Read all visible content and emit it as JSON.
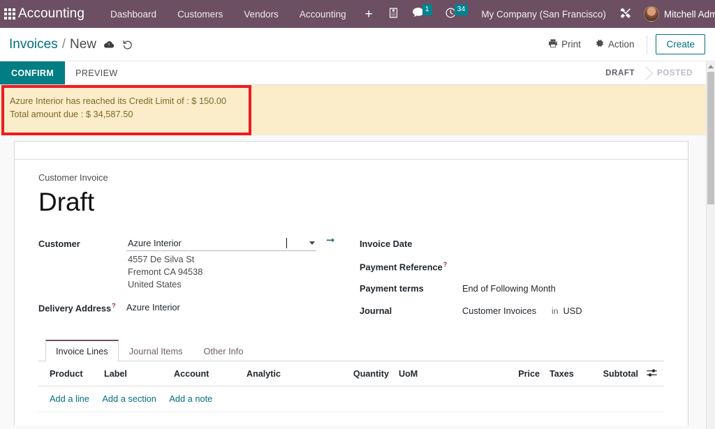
{
  "navbar": {
    "apps_icon": "apps-grid-icon",
    "brand": "Accounting",
    "menu": [
      {
        "label": "Dashboard"
      },
      {
        "label": "Customers"
      },
      {
        "label": "Vendors"
      },
      {
        "label": "Accounting"
      }
    ],
    "plus_label": "+",
    "icons": {
      "phone": "phone-icon",
      "messages": "chat-bubble-icon",
      "activities": "clock-icon",
      "debug": "tools-icon"
    },
    "messages_badge": "1",
    "activities_badge": "34",
    "company": "My Company (San Francisco)",
    "user": "Mitchell Admin"
  },
  "control_panel": {
    "breadcrumb_parent": "Invoices",
    "breadcrumb_sep": "/",
    "breadcrumb_current": "New",
    "save_icon": "cloud-save-icon",
    "discard_icon": "discard-undo-icon",
    "print_label": "Print",
    "action_label": "Action",
    "create_label": "Create"
  },
  "status_row": {
    "confirm_label": "CONFIRM",
    "preview_label": "PREVIEW",
    "stages": [
      {
        "label": "DRAFT",
        "state": "active"
      },
      {
        "label": "POSTED",
        "state": "inactive"
      }
    ]
  },
  "warning": {
    "line1": "Azure Interior has reached its Credit Limit of : $ 150.00",
    "line2": "Total amount due : $ 34,587.50",
    "background_color": "#fbecca",
    "text_color": "#7d6a28",
    "annotation_color": "#ee1b22"
  },
  "form": {
    "subtitle": "Customer Invoice",
    "title": "Draft",
    "customer": {
      "label": "Customer",
      "value": "Azure Interior",
      "dropdown_icon": "chevron-down-icon",
      "open_record_icon": "internal-link-arrow-icon",
      "address": [
        "4557 De Silva St",
        "Fremont CA 94538",
        "United States"
      ]
    },
    "delivery_address": {
      "label": "Delivery Address",
      "help": "?",
      "value": "Azure Interior"
    },
    "invoice_date": {
      "label": "Invoice Date",
      "value": ""
    },
    "payment_reference": {
      "label": "Payment Reference",
      "help": "?",
      "value": ""
    },
    "payment_terms": {
      "label": "Payment terms",
      "value": "End of Following Month"
    },
    "journal": {
      "label": "Journal",
      "value": "Customer Invoices",
      "in_word": "in",
      "currency": "USD"
    }
  },
  "notebook": {
    "tabs": [
      {
        "label": "Invoice Lines",
        "active": true
      },
      {
        "label": "Journal Items",
        "active": false
      },
      {
        "label": "Other Info",
        "active": false
      }
    ],
    "columns": {
      "product": "Product",
      "label": "Label",
      "account": "Account",
      "analytic": "Analytic",
      "quantity": "Quantity",
      "uom": "UoM",
      "price": "Price",
      "taxes": "Taxes",
      "subtotal": "Subtotal",
      "optional_icon": "column-options-sliders-icon"
    },
    "rows": [],
    "add_line": "Add a line",
    "add_section": "Add a section",
    "add_note": "Add a note"
  },
  "theme": {
    "navbar_purple": "#6c4f63",
    "accent_teal": "#00707f",
    "confirm_teal": "#017e84",
    "badge_teal": "#00838f"
  }
}
